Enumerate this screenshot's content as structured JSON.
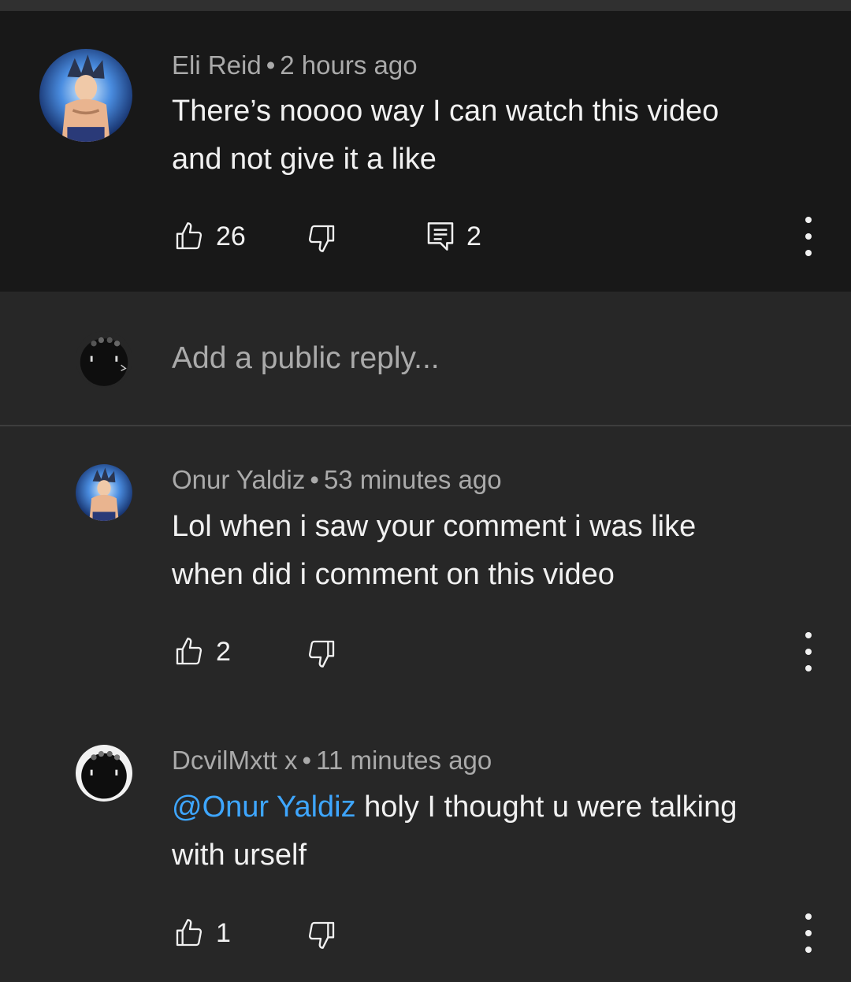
{
  "parent_comment": {
    "author": "Eli Reid",
    "time": "2 hours ago",
    "text_line1": "There’s noooo way I can watch this video",
    "text_line2": "and not give it a like",
    "likes": "26",
    "replies": "2",
    "avatar_icon": "anime-character-avatar"
  },
  "reply_input": {
    "placeholder": "Add a public reply...",
    "avatar_icon": "user-avatar"
  },
  "replies": [
    {
      "author": "Onur Yaldiz",
      "time": "53 minutes ago",
      "text_line1": "Lol when i saw your comment i was like",
      "text_line2": "when did i comment on this video",
      "likes": "2"
    },
    {
      "author": "DcvilMxtt x",
      "time": "11 minutes ago",
      "mention": "@Onur Yaldiz",
      "text_line1": " holy I thought u were talking",
      "text_line2": "with urself",
      "likes": "1"
    }
  ],
  "separator": "•",
  "colors": {
    "parent_bg": "#181818",
    "page_bg": "#272727",
    "mention": "#3ea6ff",
    "meta_text": "#aaaaaa",
    "text": "#f1f1f1"
  }
}
